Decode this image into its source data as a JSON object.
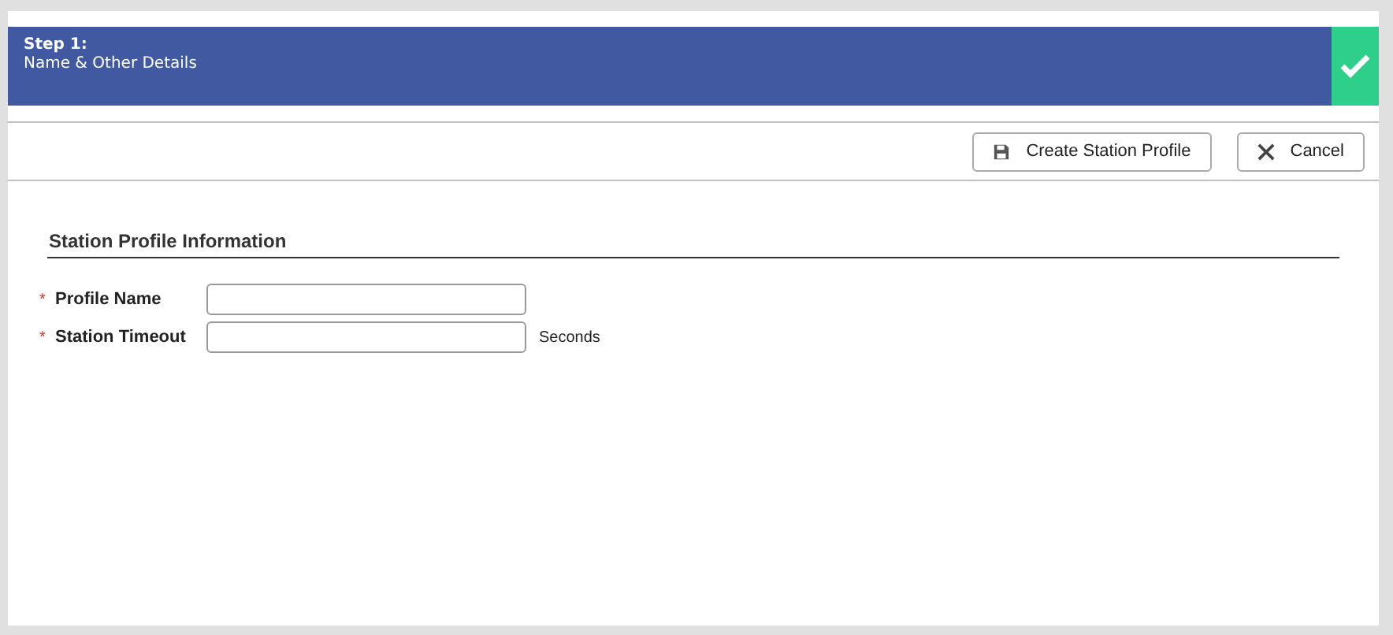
{
  "step": {
    "title": "Step 1:",
    "subtitle": "Name & Other Details",
    "completed": true
  },
  "toolbar": {
    "buttons": [
      {
        "label": "Create Station Profile",
        "kind": "save"
      },
      {
        "label": "Cancel",
        "kind": "cancel"
      }
    ]
  },
  "section": {
    "title": "Station Profile Information"
  },
  "fields": [
    {
      "required_mark": "*",
      "label": "Profile Name"
    },
    {
      "required_mark": "*",
      "label": "Station Timeout",
      "suffix": "Seconds"
    }
  ]
}
